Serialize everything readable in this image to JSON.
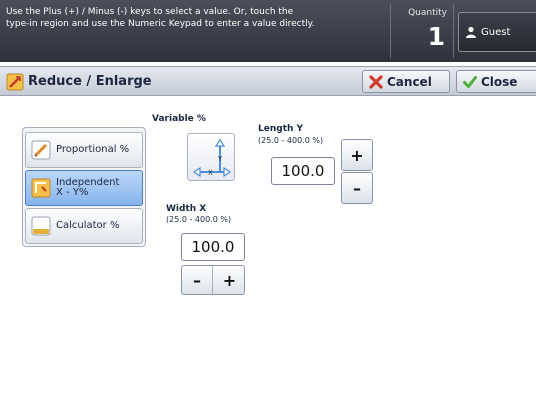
{
  "header": {
    "message_line1": "Use the Plus (+) / Minus (-) keys to select a value.  Or, touch the",
    "message_line2": "type-in region and use the Numeric Keypad to enter a value directly.",
    "quantity_label": "Quantity",
    "quantity_value": "1",
    "user_label": "Guest"
  },
  "titlebar": {
    "title": "Reduce / Enlarge",
    "cancel_label": "Cancel",
    "close_label": "Close"
  },
  "modes": {
    "items": [
      {
        "label_line1": "Proportional %",
        "label_line2": "",
        "selected": false
      },
      {
        "label_line1": "Independent",
        "label_line2": "X - Y%",
        "selected": true
      },
      {
        "label_line1": "Calculator %",
        "label_line2": "",
        "selected": false
      }
    ]
  },
  "variable": {
    "label": "Variable %",
    "diagram_x": "X",
    "diagram_y": "Y"
  },
  "length_y": {
    "label": "Length Y",
    "range": "(25.0 - 400.0 %)",
    "value": "100.0",
    "plus": "+",
    "minus": "–"
  },
  "width_x": {
    "label": "Width X",
    "range": "(25.0 - 400.0 %)",
    "value": "100.0",
    "plus": "+",
    "minus": "–"
  },
  "colors": {
    "accent": "#86b5ec",
    "cancel_icon": "#d23a2a",
    "close_icon": "#4caf3a"
  }
}
